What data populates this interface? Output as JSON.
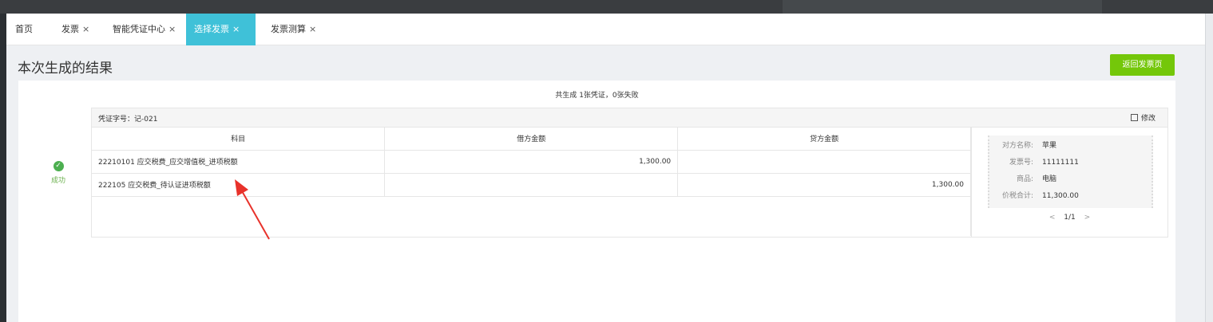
{
  "tabs": [
    {
      "label": "首页",
      "closable": false,
      "active": false
    },
    {
      "label": "发票",
      "closable": true,
      "active": false
    },
    {
      "label": "智能凭证中心",
      "closable": true,
      "active": false
    },
    {
      "label": "选择发票",
      "closable": true,
      "active": true
    },
    {
      "label": "发票测算",
      "closable": true,
      "active": false
    }
  ],
  "close_glyph": "×",
  "page": {
    "title": "本次生成的结果",
    "return_button": "返回发票页",
    "summary": "共生成 1张凭证，0张失败"
  },
  "status": {
    "label": "成功",
    "icon": "check-circle-icon",
    "color": "#4caf50"
  },
  "voucher": {
    "number_label": "凭证字号：记-021",
    "modify_label": "修改",
    "columns": [
      "科目",
      "借方金额",
      "贷方金额"
    ],
    "rows": [
      {
        "subject": "22210101 应交税费_应交增值税_进项税额",
        "debit": "1,300.00",
        "credit": ""
      },
      {
        "subject": "222105 应交税费_待认证进项税额",
        "debit": "",
        "credit": "1,300.00"
      }
    ]
  },
  "invoice_info": [
    {
      "key": "对方名称:",
      "value": "苹果"
    },
    {
      "key": "发票号:",
      "value": "11111111"
    },
    {
      "key": "商品:",
      "value": "电脑"
    },
    {
      "key": "价税合计:",
      "value": "11,300.00"
    }
  ],
  "pager": {
    "prev": "<",
    "current": "1/1",
    "next": ">"
  },
  "colors": {
    "accent_tab": "#3fc1d8",
    "return_button": "#74c70a",
    "success": "#4caf50",
    "annotation_arrow": "#e8322b"
  }
}
